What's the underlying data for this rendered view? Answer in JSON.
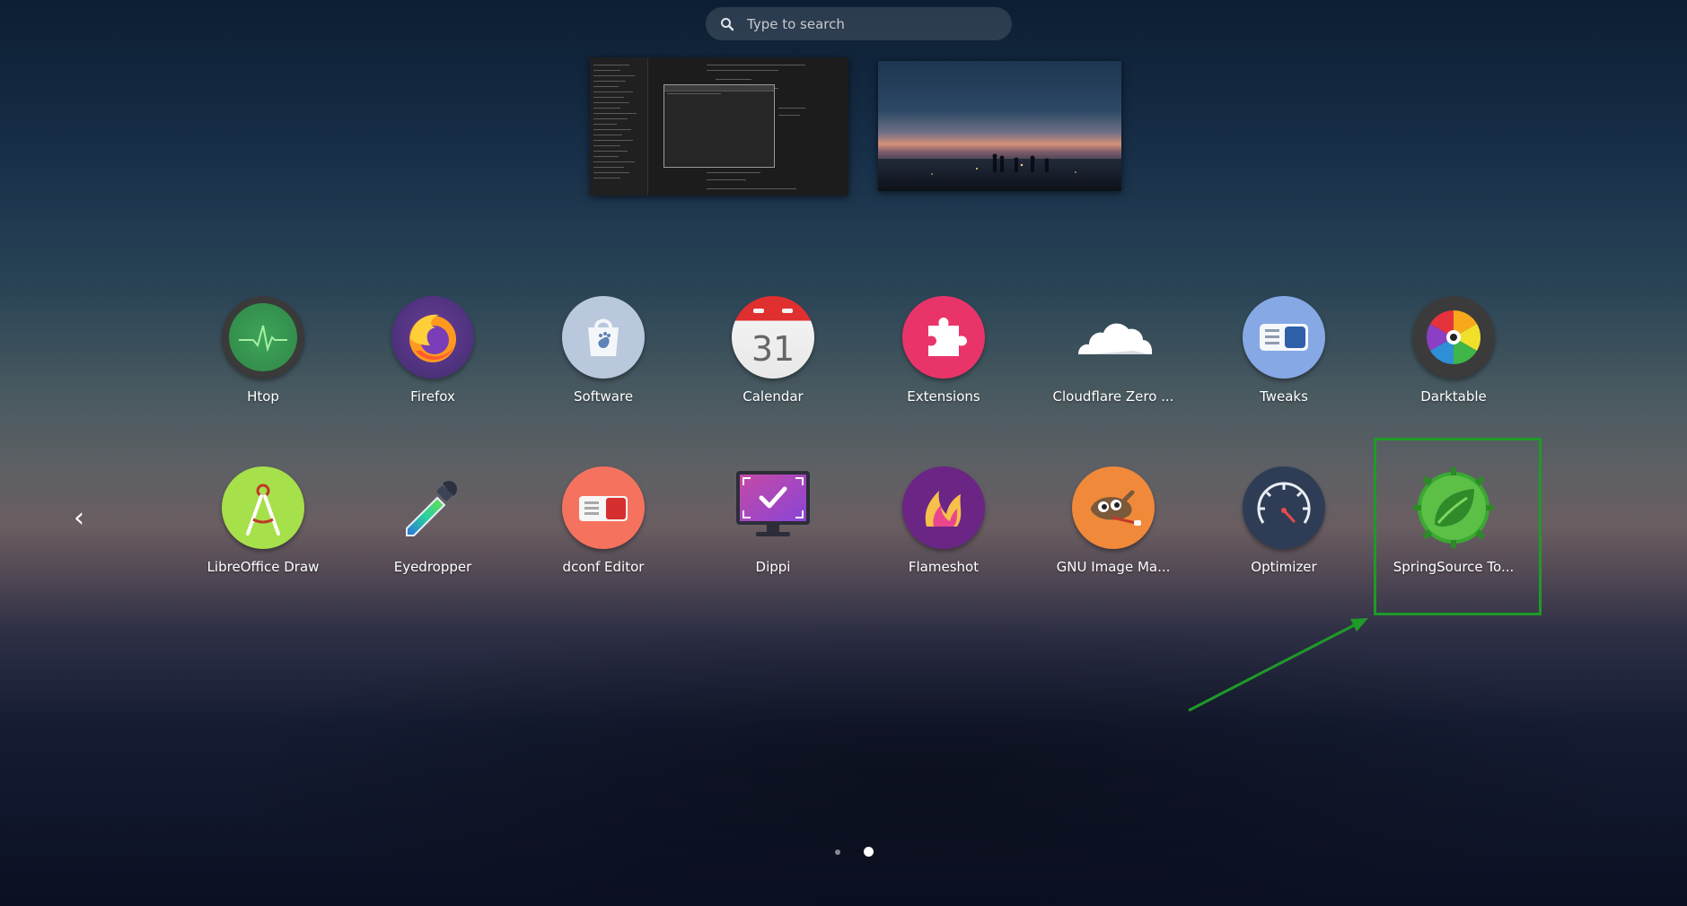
{
  "search": {
    "placeholder": "Type to search"
  },
  "windows": [
    {
      "name": "terminal-window"
    },
    {
      "name": "wallpaper-window"
    }
  ],
  "apps_row1": [
    {
      "label": "Htop",
      "icon": "htop-icon"
    },
    {
      "label": "Firefox",
      "icon": "firefox-icon"
    },
    {
      "label": "Software",
      "icon": "software-icon"
    },
    {
      "label": "Calendar",
      "icon": "calendar-icon",
      "day": "31"
    },
    {
      "label": "Extensions",
      "icon": "extensions-icon"
    },
    {
      "label": "Cloudflare Zero ...",
      "icon": "cloudflare-icon"
    },
    {
      "label": "Tweaks",
      "icon": "tweaks-icon"
    },
    {
      "label": "Darktable",
      "icon": "darktable-icon"
    }
  ],
  "apps_row2": [
    {
      "label": "LibreOffice Draw",
      "icon": "libreoffice-draw-icon"
    },
    {
      "label": "Eyedropper",
      "icon": "eyedropper-icon"
    },
    {
      "label": "dconf Editor",
      "icon": "dconf-editor-icon"
    },
    {
      "label": "Dippi",
      "icon": "dippi-icon"
    },
    {
      "label": "Flameshot",
      "icon": "flameshot-icon"
    },
    {
      "label": "GNU Image Ma...",
      "icon": "gimp-icon"
    },
    {
      "label": "Optimizer",
      "icon": "optimizer-icon"
    },
    {
      "label": "SpringSource To...",
      "icon": "springsource-icon"
    }
  ],
  "nav": {
    "prev_glyph": "‹"
  },
  "pagination": {
    "pages": 2,
    "current": 2
  },
  "colors": {
    "highlight": "#1e9a28"
  }
}
